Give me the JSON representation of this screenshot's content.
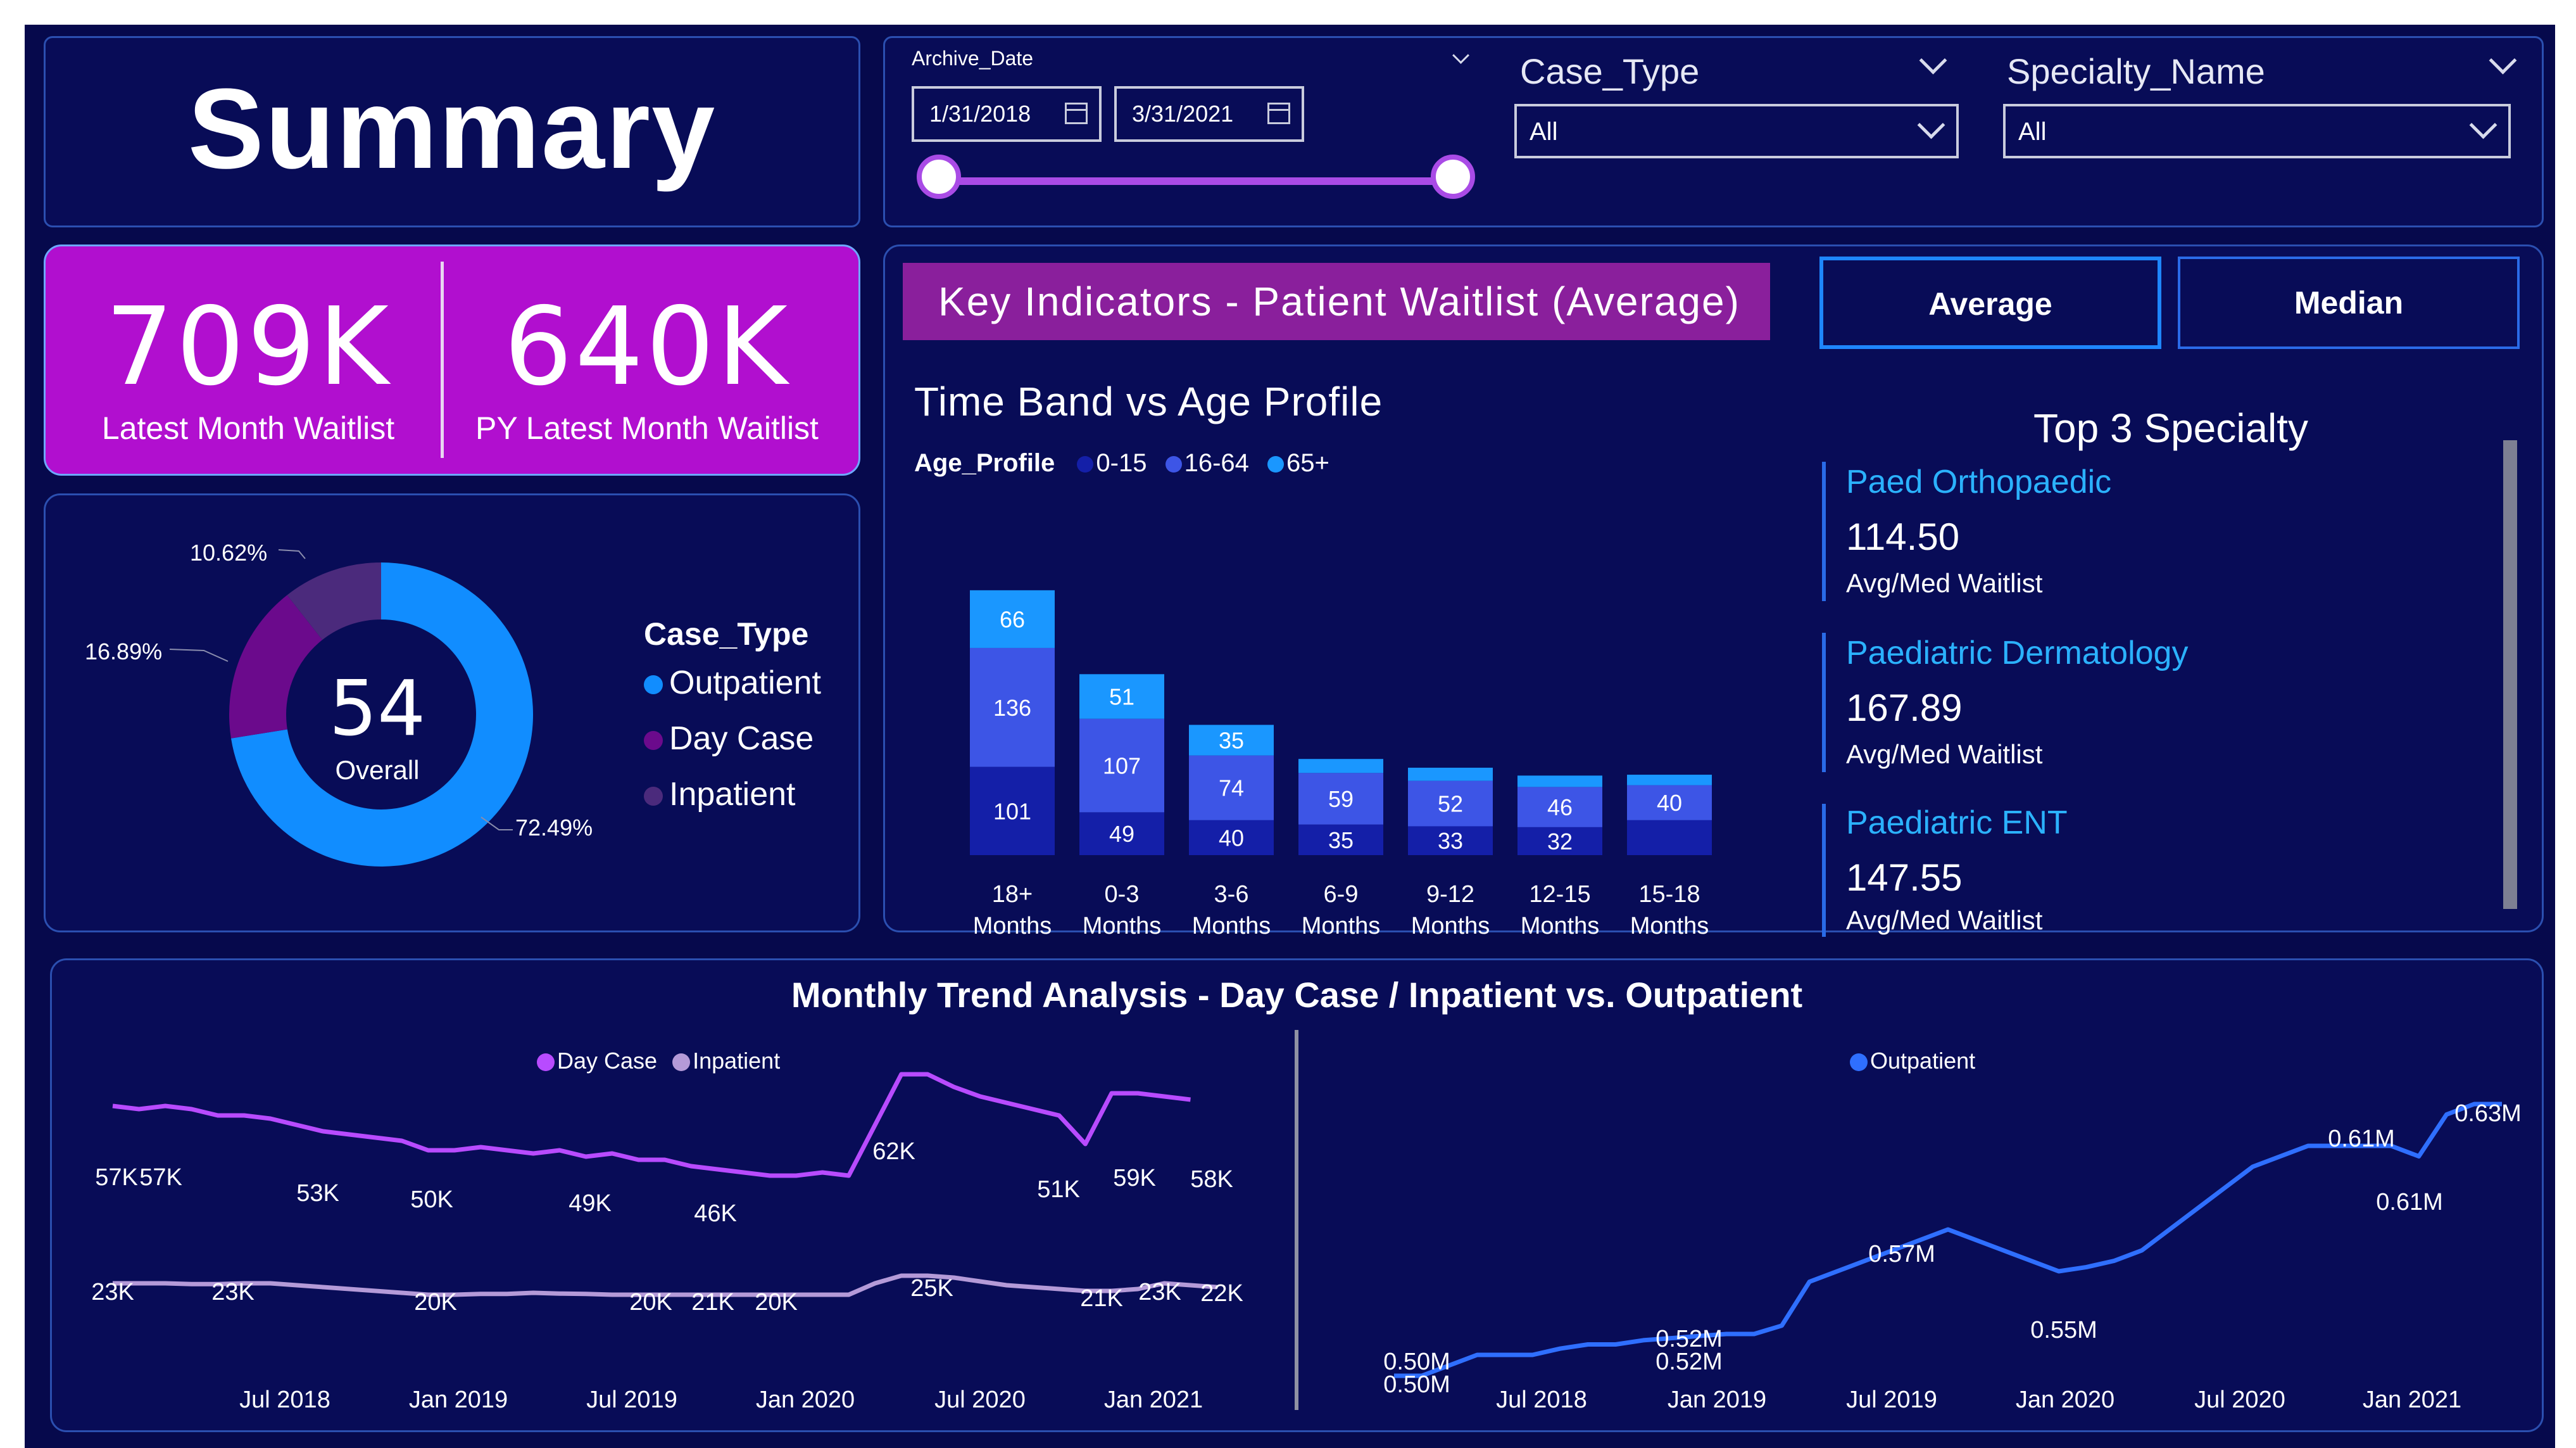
{
  "summary": {
    "title": "Summary"
  },
  "filters": {
    "archive_date": {
      "label": "Archive_Date",
      "start": "1/31/2018",
      "end": "3/31/2021"
    },
    "case_type": {
      "label": "Case_Type",
      "value": "All"
    },
    "specialty_name": {
      "label": "Specialty_Name",
      "value": "All"
    }
  },
  "kpis": [
    {
      "value": "709K",
      "label": "Latest Month Waitlist"
    },
    {
      "value": "640K",
      "label": "PY Latest Month Waitlist"
    }
  ],
  "donut": {
    "center_value": "54",
    "center_label": "Overall",
    "legend_title": "Case_Type",
    "slices": [
      {
        "name": "Outpatient",
        "pct": 72.49,
        "label": "72.49%",
        "color": "#118dff"
      },
      {
        "name": "Day Case",
        "pct": 16.89,
        "label": "16.89%",
        "color": "#6b0a8c"
      },
      {
        "name": "Inpatient",
        "pct": 10.62,
        "label": "10.62%",
        "color": "#4b2a7c"
      }
    ]
  },
  "key_indicators": {
    "banner": "Key Indicators - Patient Waitlist (Average)",
    "chart_title": "Time Band vs Age Profile",
    "legend_title": "Age_Profile",
    "toggle_average": "Average",
    "toggle_median": "Median",
    "top3_title": "Top 3 Specialty",
    "top3": [
      {
        "name": "Paed Orthopaedic",
        "value": "114.50",
        "sub": "Avg/Med Waitlist"
      },
      {
        "name": "Paediatric Dermatology",
        "value": "167.89",
        "sub": "Avg/Med Waitlist"
      },
      {
        "name": "Paediatric ENT",
        "value": "147.55",
        "sub": "Avg/Med Waitlist"
      }
    ]
  },
  "trend": {
    "title": "Monthly Trend Analysis - Day Case / Inpatient vs. Outpatient",
    "left_x_ticks": [
      "Jul 2018",
      "Jan 2019",
      "Jul 2019",
      "Jan 2020",
      "Jul 2020",
      "Jan 2021"
    ],
    "right_x_ticks": [
      "Jul 2018",
      "Jan 2019",
      "Jul 2019",
      "Jan 2020",
      "Jul 2020",
      "Jan 2021"
    ]
  },
  "chart_data": [
    {
      "type": "bar",
      "stacked": true,
      "title": "Time Band vs Age Profile",
      "legend_title": "Age_Profile",
      "categories": [
        "18+ Months",
        "0-3 Months",
        "3-6 Months",
        "6-9 Months",
        "9-12 Months",
        "12-15 Months",
        "15-18 Months"
      ],
      "series": [
        {
          "name": "0-15",
          "color": "#141fa8",
          "values": [
            101,
            49,
            40,
            35,
            33,
            32,
            40
          ]
        },
        {
          "name": "16-64",
          "color": "#3d55e6",
          "values": [
            136,
            107,
            74,
            59,
            52,
            46,
            40
          ]
        },
        {
          "name": "65+",
          "color": "#1a97ff",
          "values": [
            66,
            51,
            35,
            16,
            15,
            13,
            12
          ]
        }
      ],
      "visible_labels": {
        "0-15": [
          101,
          49,
          40,
          35,
          33,
          32
        ],
        "16-64": [
          136,
          107,
          74,
          59,
          52,
          46,
          40
        ],
        "65+": [
          66,
          51,
          35
        ]
      }
    },
    {
      "type": "pie",
      "donut": true,
      "legend_title": "Case_Type",
      "categories": [
        "Outpatient",
        "Day Case",
        "Inpatient"
      ],
      "values": [
        72.49,
        16.89,
        10.62
      ],
      "labels": [
        "72.49%",
        "16.89%",
        "10.62%"
      ]
    },
    {
      "type": "line",
      "x": [
        "Jan 2018",
        "Feb 2018",
        "Mar 2018",
        "Apr 2018",
        "May 2018",
        "Jun 2018",
        "Jul 2018",
        "Aug 2018",
        "Sep 2018",
        "Oct 2018",
        "Nov 2018",
        "Dec 2018",
        "Jan 2019",
        "Feb 2019",
        "Mar 2019",
        "Apr 2019",
        "May 2019",
        "Jun 2019",
        "Jul 2019",
        "Aug 2019",
        "Sep 2019",
        "Oct 2019",
        "Nov 2019",
        "Dec 2019",
        "Jan 2020",
        "Feb 2020",
        "Mar 2020",
        "Apr 2020",
        "May 2020",
        "Jun 2020",
        "Jul 2020",
        "Aug 2020",
        "Sep 2020",
        "Oct 2020",
        "Nov 2020",
        "Dec 2020",
        "Jan 2021",
        "Feb 2021",
        "Mar 2021"
      ],
      "x_ticks": [
        "Jul 2018",
        "Jan 2019",
        "Jul 2019",
        "Jan 2020",
        "Jul 2020",
        "Jan 2021"
      ],
      "series": [
        {
          "name": "Day Case",
          "color": "#b84bff",
          "values": [
            57,
            56.5,
            57,
            56.5,
            55.5,
            55.5,
            55,
            54,
            53,
            52.5,
            52,
            51.5,
            50,
            50,
            50.5,
            50,
            49.5,
            50,
            49,
            49.5,
            48.5,
            48.5,
            47.5,
            47,
            46.5,
            46,
            46,
            46.5,
            46,
            54,
            62,
            62,
            60,
            58.5,
            57.5,
            56.5,
            55.5,
            51,
            59,
            59,
            58.5,
            58
          ],
          "labels": [
            "57K",
            "57K",
            "53K",
            "50K",
            "49K",
            "46K",
            "62K",
            "51K",
            "59K",
            "58K"
          ]
        },
        {
          "name": "Inpatient",
          "color": "#b49ad8",
          "values": [
            23,
            23,
            23,
            22.8,
            22.8,
            23,
            23,
            22.5,
            22,
            21.5,
            21,
            20.5,
            20,
            20,
            20.2,
            20.2,
            20.5,
            20.3,
            20.2,
            20,
            20,
            20,
            20,
            20,
            20,
            20,
            20,
            20,
            20,
            23,
            25,
            25,
            24.5,
            23.5,
            22.5,
            22,
            21.5,
            21,
            21,
            21.5,
            23,
            22.5,
            22
          ],
          "labels": [
            "23K",
            "23K",
            "20K",
            "20K",
            "21K",
            "20K",
            "25K",
            "21K",
            "23K",
            "22K"
          ]
        }
      ]
    },
    {
      "type": "line",
      "x_ticks": [
        "Jul 2018",
        "Jan 2019",
        "Jul 2019",
        "Jan 2020",
        "Jul 2020",
        "Jan 2021"
      ],
      "series": [
        {
          "name": "Outpatient",
          "color": "#2f6fff",
          "values": [
            0.5,
            0.5,
            0.505,
            0.51,
            0.51,
            0.51,
            0.513,
            0.515,
            0.515,
            0.517,
            0.518,
            0.519,
            0.52,
            0.52,
            0.524,
            0.545,
            0.55,
            0.555,
            0.56,
            0.565,
            0.57,
            0.565,
            0.56,
            0.555,
            0.55,
            0.552,
            0.555,
            0.56,
            0.57,
            0.58,
            0.59,
            0.6,
            0.605,
            0.61,
            0.61,
            0.61,
            0.61,
            0.605,
            0.625,
            0.63,
            0.63
          ],
          "labels": [
            "0.50M",
            "0.50M",
            "0.52M",
            "0.52M",
            "0.57M",
            "0.55M",
            "0.61M",
            "0.61M",
            "0.63M"
          ]
        }
      ]
    }
  ]
}
